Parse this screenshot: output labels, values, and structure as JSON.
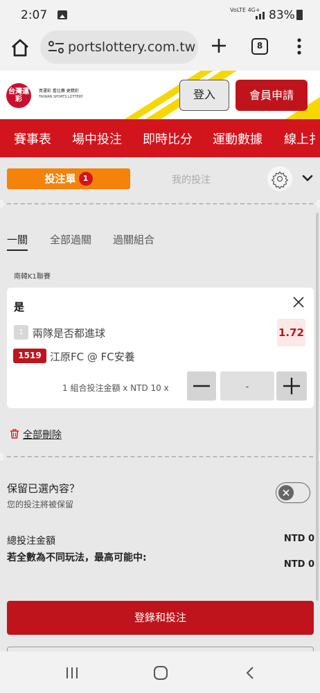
{
  "status_bar": {
    "time": "2:07",
    "network": "VoLTE 4G+",
    "battery": "83%"
  },
  "browser": {
    "url": "portslottery.com.tw",
    "tab_count": "8"
  },
  "site_header": {
    "logo_text": "台灣運彩",
    "logo_line1": "買運彩 看比賽 更精彩",
    "logo_line2": "TAIWAN SPORTS LOTTERY",
    "login_label": "登入",
    "register_label": "會員申請"
  },
  "nav": {
    "items": [
      "賽事表",
      "場中投注",
      "即時比分",
      "運動數據",
      "線上扌"
    ]
  },
  "betslip": {
    "tab_betslip": "投注單",
    "betslip_count": "1",
    "tab_mybets": "我的投注",
    "bet_types": [
      "一關",
      "全部過關",
      "過關組合"
    ],
    "league": "南韓K1聯賽",
    "selection": {
      "pick": "是",
      "leg_number": "1",
      "market": "兩隊是否都進球",
      "odds": "1.72",
      "event_id": "1519",
      "match": "江原FC @ FC安養",
      "stake_label": "1 組合投注金額 x NTD 10 x",
      "stake_value": "-"
    },
    "delete_all": "全部刪除",
    "keep": {
      "title": "保留已選內容？",
      "subtitle": "您的投注將被保留",
      "enabled": false
    },
    "total_label": "總投注金額",
    "total_value": "NTD 0",
    "max_win_label": "若全數為不同玩法，最高可能中:",
    "max_win_value": "NTD 0",
    "submit_label": "登錄和投注"
  },
  "colors": {
    "brand_red": "#d2141c",
    "accent_orange": "#f5820a",
    "odds_red": "#c0141c",
    "stripe_yellow": "#f6d800"
  }
}
